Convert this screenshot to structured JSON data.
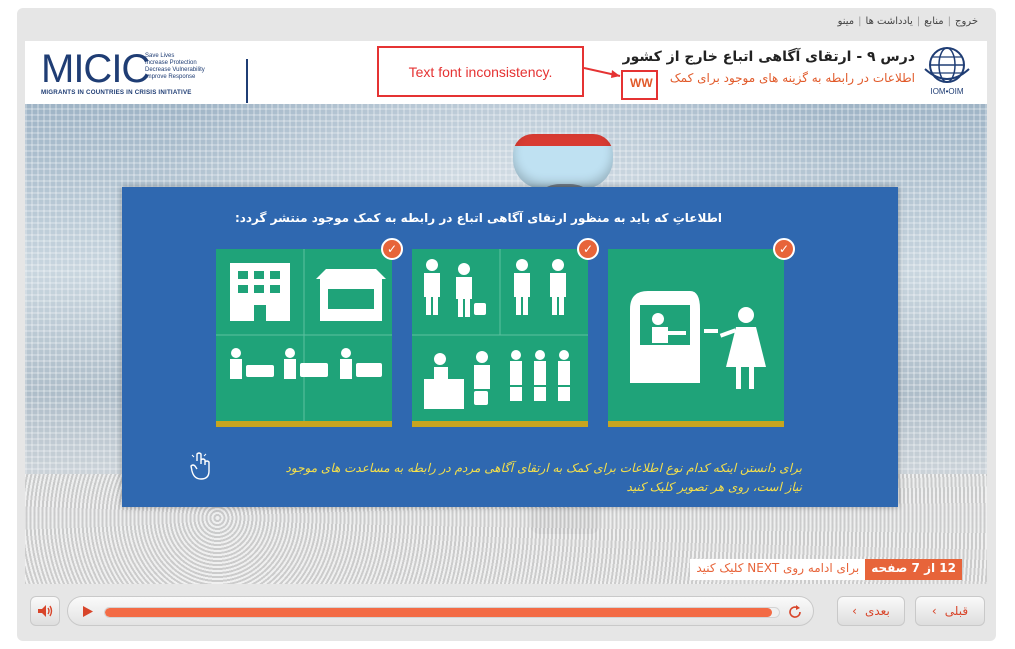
{
  "topnav": {
    "items": [
      "خروج",
      "منابع",
      "یادداشت ها",
      "مینو"
    ]
  },
  "header": {
    "micic": {
      "word": "MICIC",
      "tagline": [
        "Save Lives",
        "Increase Protection",
        "Decrease Vulnerability",
        "Improve Response"
      ],
      "subtitle": "MIGRANTS IN COUNTRIES IN CRISIS INITIATIVE"
    },
    "lesson_title": "درس ۹ - ارتقای آگاهی اتباع خارج از کشور",
    "lesson_subtitle": "اطلاعات در رابطه به گزینه های موجود برای کمک",
    "iom_label": "IOM•OIM"
  },
  "annotation": {
    "label": "Text font inconsistency.",
    "marker_text": "WW"
  },
  "panel": {
    "title": "اطلاعاتِ که باید به منظور ارتقای آگاهی اتباع در رابطه به کمک موجود منتشر گردد:",
    "hint": "برای دانستن اینکه کدام نوع اطلاعات برای کمک به ارتقای آگاهی مردم در رابطه به مساعدت های موجود نیاز است، روی هر تصویر کلیک کنید",
    "cards": [
      {
        "name": "buildings-emergency-card",
        "checked": true
      },
      {
        "name": "officials-travel-card",
        "checked": true
      },
      {
        "name": "service-counter-card",
        "checked": true
      }
    ]
  },
  "status": {
    "counter": "12 از 7 صفحه",
    "next_text": "برای ادامه روی NEXT کلیک کنید"
  },
  "controls": {
    "next_label": "بعدی",
    "prev_label": "قبلی",
    "progress": 0.99
  },
  "colors": {
    "accent": "#e7643a",
    "panel": "#2f68b0",
    "card": "#1fa379",
    "hint": "#f5e04a"
  }
}
